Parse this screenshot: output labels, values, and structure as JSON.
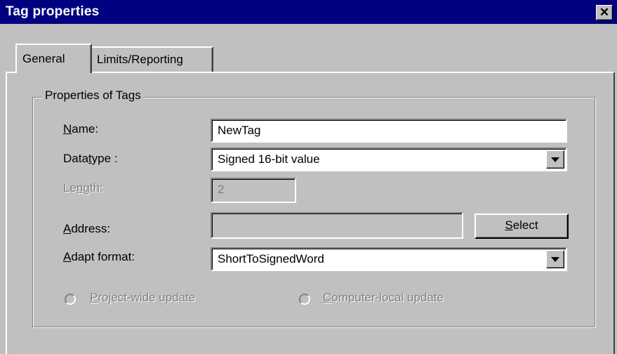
{
  "window": {
    "title": "Tag properties",
    "close_symbol": "✕"
  },
  "tabs": [
    {
      "label": "General",
      "active": true
    },
    {
      "label": "Limits/Reporting",
      "active": false
    }
  ],
  "group": {
    "label": "Properties of Tags"
  },
  "fields": {
    "name": {
      "label_mnemonic": "N",
      "label_rest": "ame:",
      "value": "NewTag"
    },
    "datatype": {
      "label_pre": "Data",
      "label_mnemonic": "t",
      "label_post": "ype :",
      "value": "Signed 16-bit value"
    },
    "length": {
      "label_pre": "Le",
      "label_mnemonic": "n",
      "label_post": "gth:",
      "value": "2",
      "disabled": true
    },
    "address": {
      "label_mnemonic": "A",
      "label_rest": "ddress:",
      "value": "",
      "select_mnemonic": "S",
      "select_rest": "elect"
    },
    "adapt_format": {
      "label_mnemonic": "A",
      "label_rest": "dapt format:",
      "value": "ShortToSignedWord"
    }
  },
  "options": {
    "project_wide": {
      "mnemonic": "P",
      "rest": "roject-wide update",
      "disabled": true
    },
    "computer_local": {
      "mnemonic": "C",
      "rest": "omputer-local update",
      "disabled": true
    }
  }
}
